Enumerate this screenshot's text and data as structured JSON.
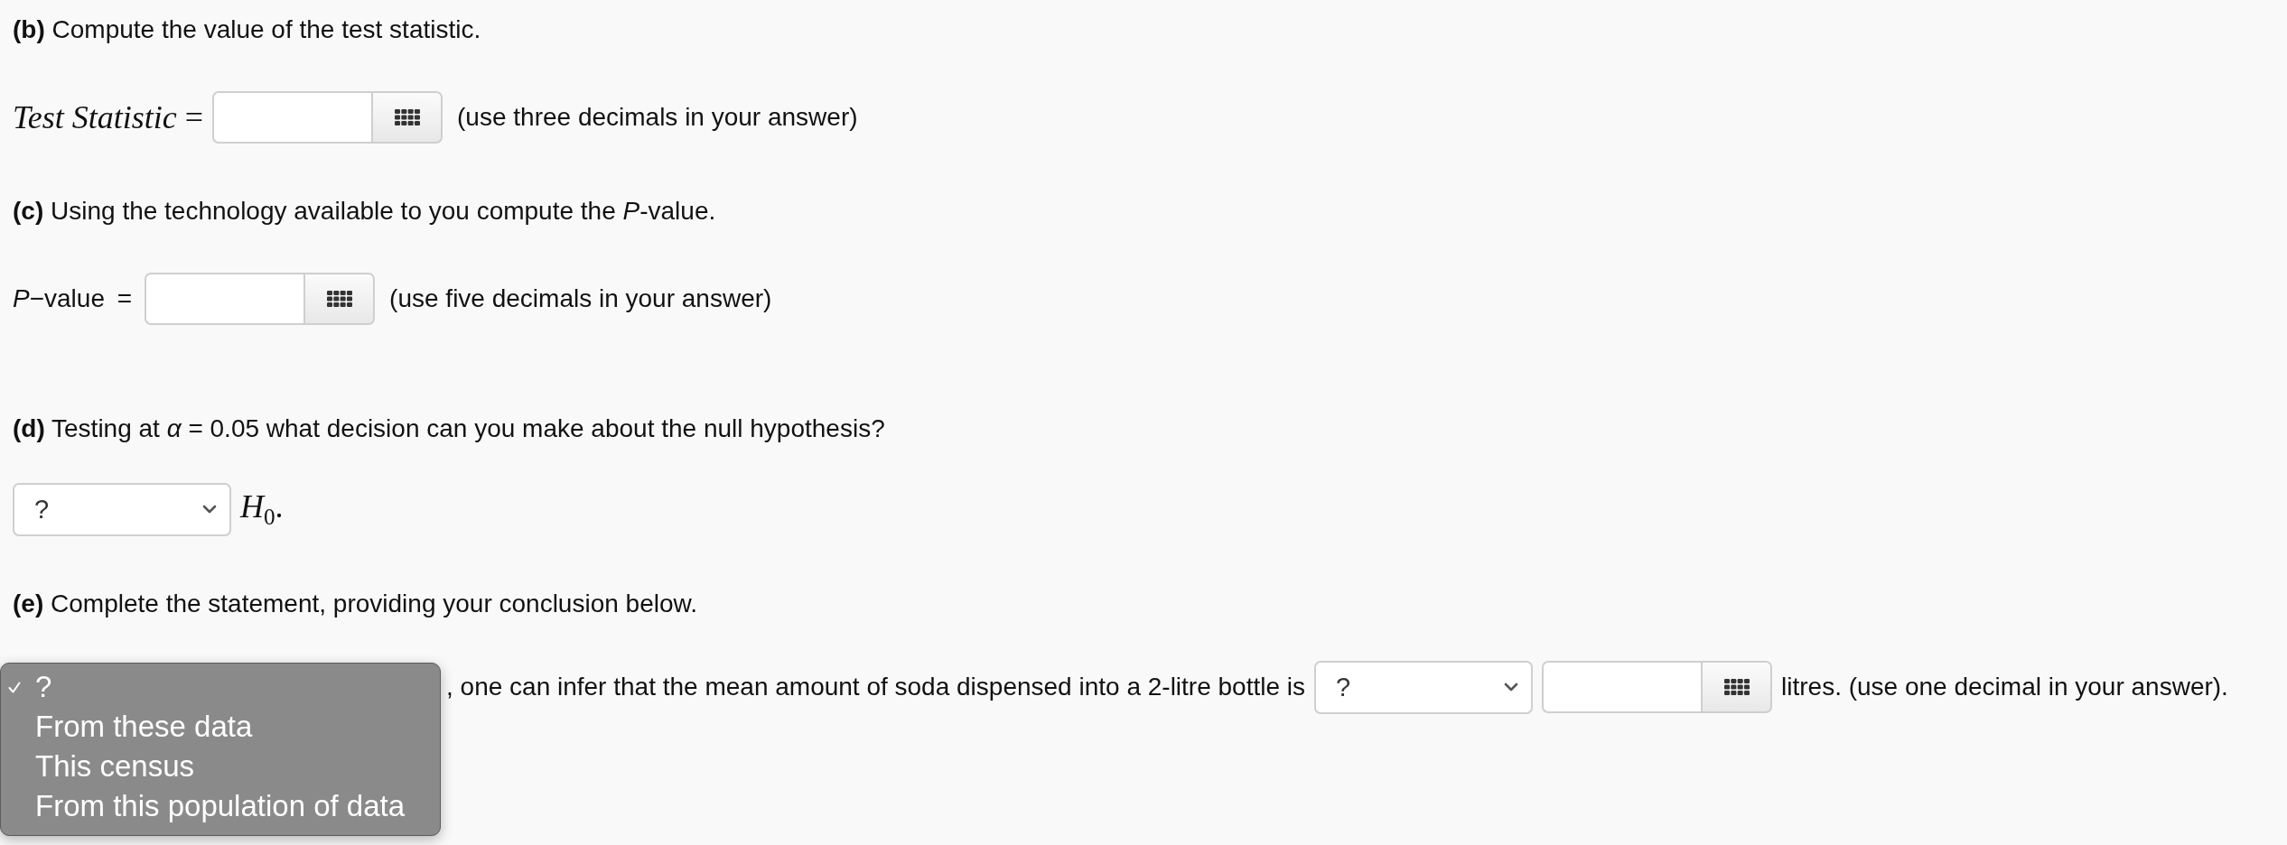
{
  "sections": [
    {
      "heading": "**(b)** Compute the value of the test statistic.",
      "row": [
        {
          "kind": "math",
          "text": "*Test Statistic* ="
        },
        {
          "kind": "numeric"
        },
        {
          "kind": "hint",
          "text": "(use three decimals in your answer)"
        }
      ]
    },
    {
      "heading": "**(c)** Using the technology available to you compute the *P*-value.",
      "row": [
        {
          "kind": "label",
          "text": "*P*−value ="
        },
        {
          "kind": "numeric"
        },
        {
          "kind": "hint",
          "text": "(use five decimals in your answer)"
        }
      ]
    },
    {
      "heading": "**(d)** Testing at *α* = 0.05 what decision can you make about the null hypothesis?",
      "row": [
        {
          "kind": "select",
          "value": "?"
        },
        {
          "kind": "math",
          "text": "*H*$_{0}$."
        }
      ]
    },
    {
      "heading": "**(e)** Complete the statement, providing your conclusion below.",
      "row": [
        {
          "kind": "menu",
          "options": [
            {
              "label": "?",
              "selected": true
            },
            {
              "label": "From these data",
              "selected": false
            },
            {
              "label": "This census",
              "selected": false
            },
            {
              "label": "From this population of data",
              "selected": false
            }
          ]
        },
        {
          "kind": "text",
          "text": ", one can infer that the mean amount of soda dispensed into a 2-litre bottle is"
        },
        {
          "kind": "select",
          "value": "?"
        },
        {
          "kind": "numeric"
        },
        {
          "kind": "text",
          "text": "litres. (use one decimal in your answer)."
        }
      ]
    }
  ]
}
